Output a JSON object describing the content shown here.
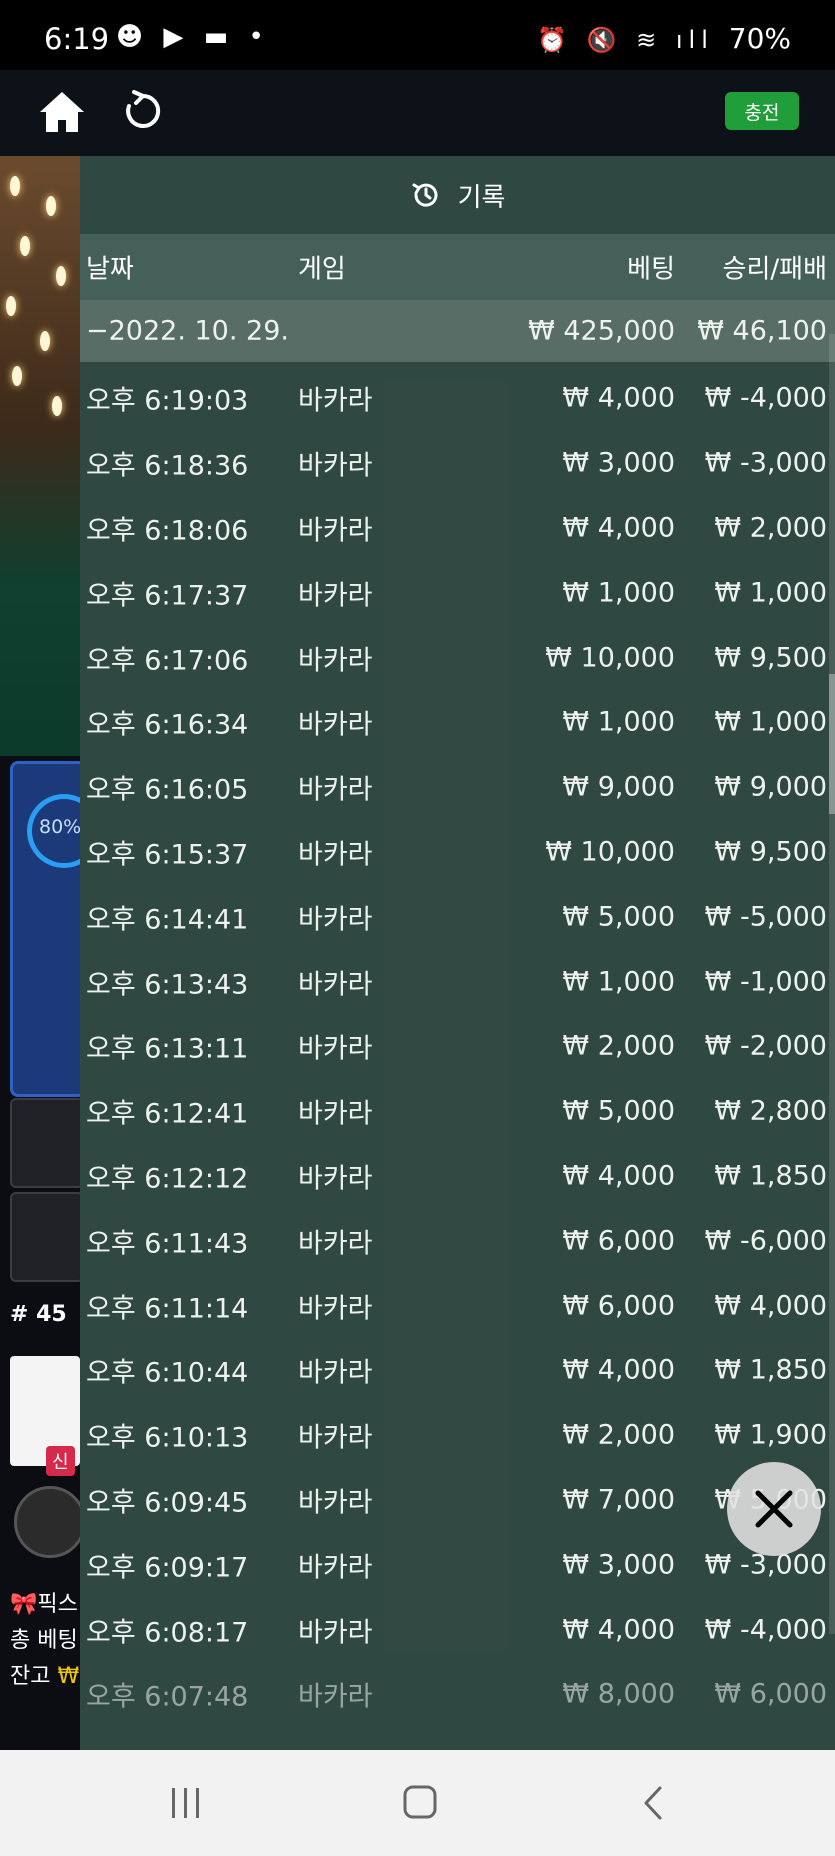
{
  "status_bar": {
    "time": "6:19",
    "left_glyphs": "☻ ▶ ▬ •",
    "right_glyphs": "⏰ 🔇 ≋ ıll",
    "battery": "70%"
  },
  "header": {
    "home_icon": "home-icon",
    "refresh_icon": "refresh-icon",
    "charge_label": "충전",
    "charge_color": "#1f9e3a"
  },
  "background": {
    "progress": "80%",
    "round": "# 45",
    "badge": "신",
    "line1": "🎀픽스",
    "line2": "총 베팅",
    "line3_label": "잔고 ",
    "line3_value": "₩"
  },
  "history": {
    "title": "기록",
    "columns": {
      "date": "날짜",
      "game": "게임",
      "bet": "베팅",
      "result": "승리/패배"
    },
    "summary": {
      "date": "−2022. 10. 29.",
      "bet": "₩ 425,000",
      "result": "₩ 46,100"
    },
    "rows": [
      {
        "time": "오후 6:19:03",
        "game": "바카라",
        "bet": "₩ 4,000",
        "result": "₩ -4,000"
      },
      {
        "time": "오후 6:18:36",
        "game": "바카라",
        "bet": "₩ 3,000",
        "result": "₩ -3,000"
      },
      {
        "time": "오후 6:18:06",
        "game": "바카라",
        "bet": "₩ 4,000",
        "result": "₩ 2,000"
      },
      {
        "time": "오후 6:17:37",
        "game": "바카라",
        "bet": "₩ 1,000",
        "result": "₩ 1,000"
      },
      {
        "time": "오후 6:17:06",
        "game": "바카라",
        "bet": "₩ 10,000",
        "result": "₩ 9,500"
      },
      {
        "time": "오후 6:16:34",
        "game": "바카라",
        "bet": "₩ 1,000",
        "result": "₩ 1,000"
      },
      {
        "time": "오후 6:16:05",
        "game": "바카라",
        "bet": "₩ 9,000",
        "result": "₩ 9,000"
      },
      {
        "time": "오후 6:15:37",
        "game": "바카라",
        "bet": "₩ 10,000",
        "result": "₩ 9,500"
      },
      {
        "time": "오후 6:14:41",
        "game": "바카라",
        "bet": "₩ 5,000",
        "result": "₩ -5,000"
      },
      {
        "time": "오후 6:13:43",
        "game": "바카라",
        "bet": "₩ 1,000",
        "result": "₩ -1,000"
      },
      {
        "time": "오후 6:13:11",
        "game": "바카라",
        "bet": "₩ 2,000",
        "result": "₩ -2,000"
      },
      {
        "time": "오후 6:12:41",
        "game": "바카라",
        "bet": "₩ 5,000",
        "result": "₩ 2,800"
      },
      {
        "time": "오후 6:12:12",
        "game": "바카라",
        "bet": "₩ 4,000",
        "result": "₩ 1,850"
      },
      {
        "time": "오후 6:11:43",
        "game": "바카라",
        "bet": "₩ 6,000",
        "result": "₩ -6,000"
      },
      {
        "time": "오후 6:11:14",
        "game": "바카라",
        "bet": "₩ 6,000",
        "result": "₩ 4,000"
      },
      {
        "time": "오후 6:10:44",
        "game": "바카라",
        "bet": "₩ 4,000",
        "result": "₩ 1,850"
      },
      {
        "time": "오후 6:10:13",
        "game": "바카라",
        "bet": "₩ 2,000",
        "result": "₩ 1,900"
      },
      {
        "time": "오후 6:09:45",
        "game": "바카라",
        "bet": "₩ 7,000",
        "result": "₩ 5,000"
      },
      {
        "time": "오후 6:09:17",
        "game": "바카라",
        "bet": "₩ 3,000",
        "result": "₩ -3,000"
      },
      {
        "time": "오후 6:08:17",
        "game": "바카라",
        "bet": "₩ 4,000",
        "result": "₩ -4,000"
      },
      {
        "time": "오후 6:07:48",
        "game": "바카라",
        "bet": "₩ 8,000",
        "result": "₩ 6,000"
      }
    ],
    "close_icon": "close-icon"
  },
  "nav": {
    "recent_icon": "recent-apps-icon",
    "home_icon": "nav-home-icon",
    "back_icon": "back-icon"
  }
}
